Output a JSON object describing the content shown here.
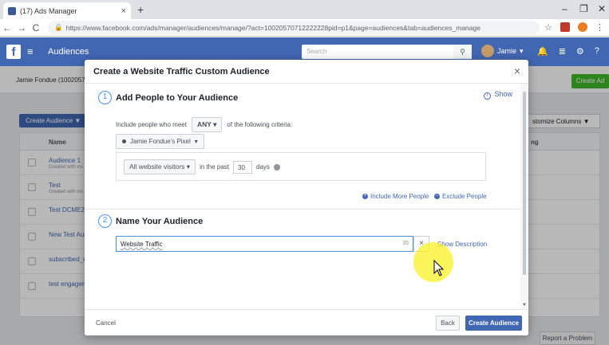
{
  "browser": {
    "tab_title": "(17) Ads Manager",
    "tab_close": "×",
    "new_tab": "+",
    "url": "https://www.facebook.com/ads/manager/audiences/manage/?act=10020570712222228pid=p1&page=audiences&tab=audiences_manage",
    "win_min": "–",
    "win_max": "❐",
    "win_close": "✕"
  },
  "fbnav": {
    "logo": "f",
    "title": "Audiences",
    "search_placeholder": "Search",
    "user": "Jamie"
  },
  "page": {
    "account_name": "Jamie Fondue (10020570",
    "create_ad": "Create Ad",
    "create_audience": "Create Audience ▼",
    "customize_columns": "stomize Columns ▼",
    "col_name": "Name",
    "col_extra": "ng",
    "rows": [
      {
        "name": "Audience 1",
        "sub": "Created with ins"
      },
      {
        "name": "Test",
        "sub": "Created with ins"
      },
      {
        "name": "Test DCME2 A",
        "sub": ""
      },
      {
        "name": "New Test Audi",
        "sub": ""
      },
      {
        "name": "subscribed_us",
        "sub": ""
      },
      {
        "name": "test engageme",
        "sub": ""
      }
    ],
    "report": "Report a Problem"
  },
  "modal": {
    "title": "Create a Website Traffic Custom Audience",
    "close": "×",
    "step1_num": "1",
    "step1_title": "Add People to Your Audience",
    "show": "Show",
    "criteria_prefix": "Include people who meet",
    "criteria_value": "ANY ▾",
    "criteria_suffix": "of the following criteria:",
    "pixel": "Jamie Fondue's Pixel",
    "visitors": "All website visitors ▾",
    "in_past": "in the past",
    "days_value": "30",
    "days_label": "days",
    "include_more": "Include More People",
    "exclude": "Exclude People",
    "step2_num": "2",
    "step2_title": "Name Your Audience",
    "audience_name": "Website Traffic",
    "char_count": "35",
    "clear": "×",
    "show_description": "Show Description",
    "cancel": "Cancel",
    "back": "Back",
    "create": "Create Audience"
  }
}
